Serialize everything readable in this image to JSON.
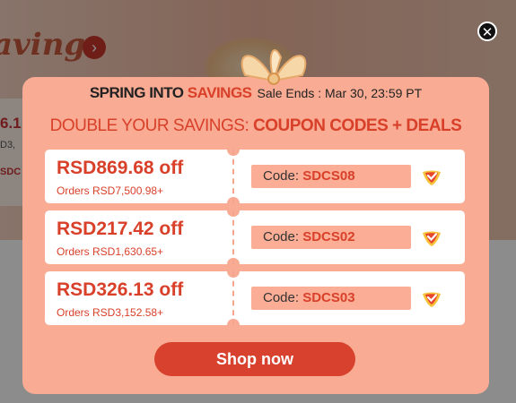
{
  "background": {
    "banner_text": "avings",
    "card_value": "6.1",
    "card_line2": "D3,",
    "card_line3": "SDC"
  },
  "popup": {
    "headline_part1": "SPRING INTO ",
    "headline_part2": "SAVINGS",
    "sale_ends": "Sale Ends : Mar 30, 23:59 PT",
    "subhead_regular": "DOUBLE YOUR SAVINGS: ",
    "subhead_bold": "COUPON CODES + DEALS",
    "coupons": [
      {
        "amount": "RSD869.68 off",
        "min": "Orders RSD7,500.98+",
        "code_label": "Code: ",
        "code": "SDCS08"
      },
      {
        "amount": "RSD217.42 off",
        "min": "Orders RSD1,630.65+",
        "code_label": "Code: ",
        "code": "SDCS02"
      },
      {
        "amount": "RSD326.13 off",
        "min": "Orders RSD3,152.58+",
        "code_label": "Code: ",
        "code": "SDCS03"
      }
    ],
    "shop_button": "Shop now"
  },
  "colors": {
    "popup_bg": "#f9ab93",
    "accent_red": "#d9402a",
    "button": "#d7412d"
  },
  "icons": {
    "close": "close-icon",
    "copy": "copy-check-icon",
    "arrow": "chevron-right-icon"
  }
}
